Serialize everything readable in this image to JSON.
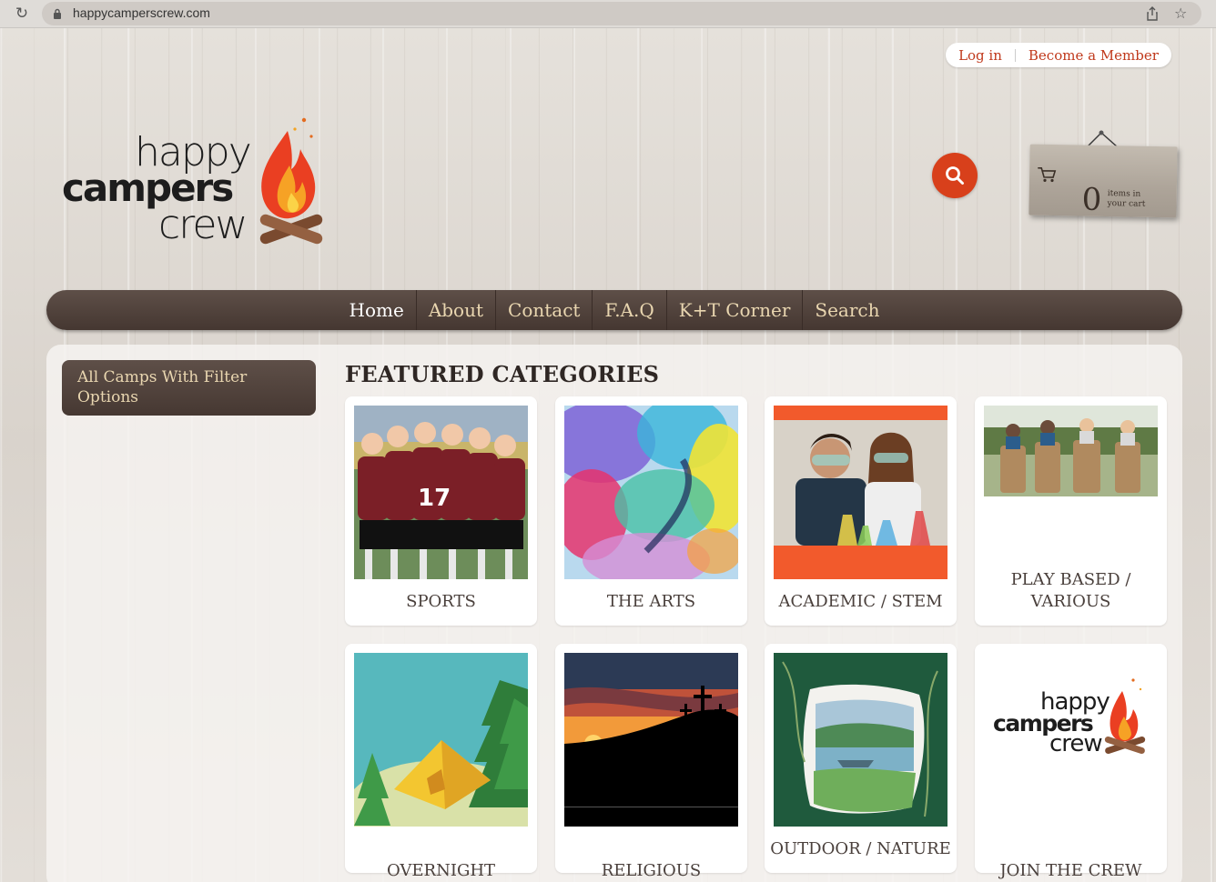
{
  "browser": {
    "url": "happycamperscrew.com"
  },
  "account": {
    "login": "Log in",
    "member": "Become a Member"
  },
  "logo": {
    "line1": "happy",
    "line2": "campers",
    "line3": "crew"
  },
  "cart": {
    "count": "0",
    "label": "items in your cart"
  },
  "nav": {
    "items": [
      "Home",
      "About",
      "Contact",
      "F.A.Q",
      "K+T Corner",
      "Search"
    ],
    "active": "Home"
  },
  "sidebar": {
    "filter_button": "All Camps With Filter Options"
  },
  "main": {
    "title": "FEATURED CATEGORIES",
    "categories": [
      {
        "label": "SPORTS",
        "image": "sports-photo"
      },
      {
        "label": "THE ARTS",
        "image": "watercolor-photo"
      },
      {
        "label": "ACADEMIC / STEM",
        "image": "lab-photo"
      },
      {
        "label": "PLAY BASED / VARIOUS",
        "image": "sack-race-photo"
      },
      {
        "label": "OVERNIGHT",
        "image": "tent-illustration"
      },
      {
        "label": "RELIGIOUS",
        "image": "crosses-sunset-photo"
      },
      {
        "label": "OUTDOOR / NATURE",
        "image": "lake-watercolor"
      },
      {
        "label": "JOIN THE CREW",
        "image": "logo-image"
      }
    ]
  },
  "colors": {
    "accent": "#c0391c",
    "search_button": "#d8401b",
    "nav_bg": "#4f413a",
    "nav_text": "#e9d6b0"
  }
}
